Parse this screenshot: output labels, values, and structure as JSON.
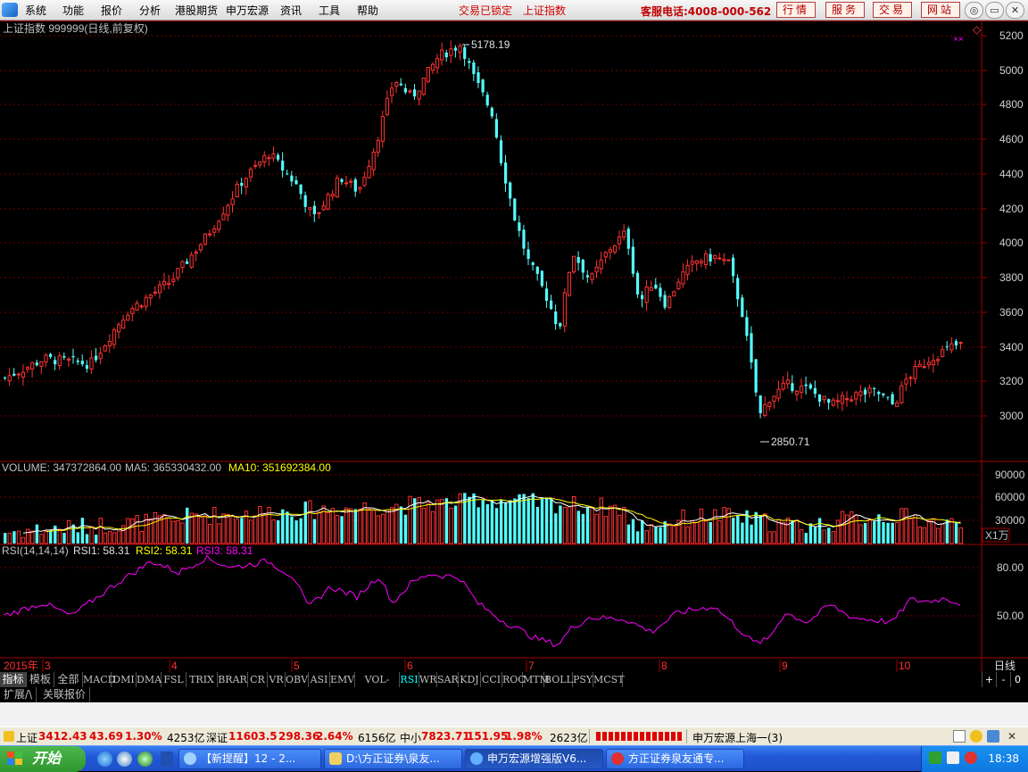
{
  "menubar": {
    "items": [
      "系统",
      "功能",
      "报价",
      "分析",
      "港股期货",
      "申万宏源",
      "资讯",
      "工具",
      "帮助"
    ],
    "lock_status": "交易已锁定",
    "index_link": "上证指数",
    "hotline": "客服电话:4008-000-562",
    "buttons": [
      "行情",
      "服务",
      "交易",
      "网站"
    ],
    "window_controls": [
      "◎",
      "▭",
      "✕"
    ]
  },
  "chart": {
    "header": "上证指数 999999(日线,前复权)",
    "corner_marker": "◇",
    "corner_marker2": "××",
    "price_axis": [
      "5200",
      "5000",
      "4800",
      "4600",
      "4400",
      "4200",
      "4000",
      "3800",
      "3600",
      "3400",
      "3200",
      "3000"
    ],
    "high_label": "5178.19",
    "low_label": "2850.71",
    "volume": {
      "label": "VOLUME: 347372864.00",
      "ma5": "MA5: 365330432.00",
      "ma10": "MA10: 351692384.00",
      "axis": [
        "90000",
        "60000",
        "30000"
      ],
      "unit": "X1万"
    },
    "rsi": {
      "label": "RSI(14,14,14)",
      "rsi1": "RSI1: 58.31",
      "rsi2": "RSI2: 58.31",
      "rsi3": "RSI3: 58.31",
      "axis": [
        "80.00",
        "50.00"
      ]
    },
    "time_axis": [
      "2015年",
      "3",
      "4",
      "5",
      "6",
      "7",
      "8",
      "9",
      "10"
    ],
    "period": "日线",
    "colors": {
      "up": "#ff3232",
      "down": "#54ffff",
      "grid": "#800000",
      "ma5": "#ffffff",
      "ma10": "#ffff00",
      "rsi": "#ff00ff"
    }
  },
  "tabs": {
    "first": "指标",
    "second": "模板",
    "third": "全部",
    "items": [
      "MACD",
      "DMI",
      "DMA",
      "FSL",
      "TRIX",
      "BRAR",
      "CR",
      "VR",
      "OBV",
      "ASI",
      "EMV",
      "VOL-TDX",
      "RSI",
      "WR",
      "SAR",
      "KDJ",
      "CCI",
      "ROC",
      "MTM",
      "BOLL",
      "PSY",
      "MCST"
    ],
    "active": "RSI",
    "controls": [
      "+",
      "-",
      "0"
    ]
  },
  "extbar": {
    "items": [
      "扩展/\\",
      "关联报价"
    ]
  },
  "status": {
    "sh_name": "上证",
    "sh_value": "3412.43",
    "sh_change": "43.69",
    "sh_pct": "1.30%",
    "sh_amount": "4253亿",
    "sz_name": "深证",
    "sz_value": "11603.5",
    "sz_change": "298.36",
    "sz_pct": "2.64%",
    "sz_amount": "6156亿",
    "zx_name": "中小",
    "zx_value": "7823.71",
    "zx_change": "151.95",
    "zx_pct": "1.98%",
    "zx_amount": "2623亿",
    "server": "申万宏源上海一(3)"
  },
  "taskbar": {
    "start": "开始",
    "tasks": [
      "【新提醒】12 - 2...",
      "D:\\方正证券\\泉友...",
      "申万宏源增强版V6...",
      "方正证券泉友通专..."
    ],
    "clock": "18:38"
  }
}
